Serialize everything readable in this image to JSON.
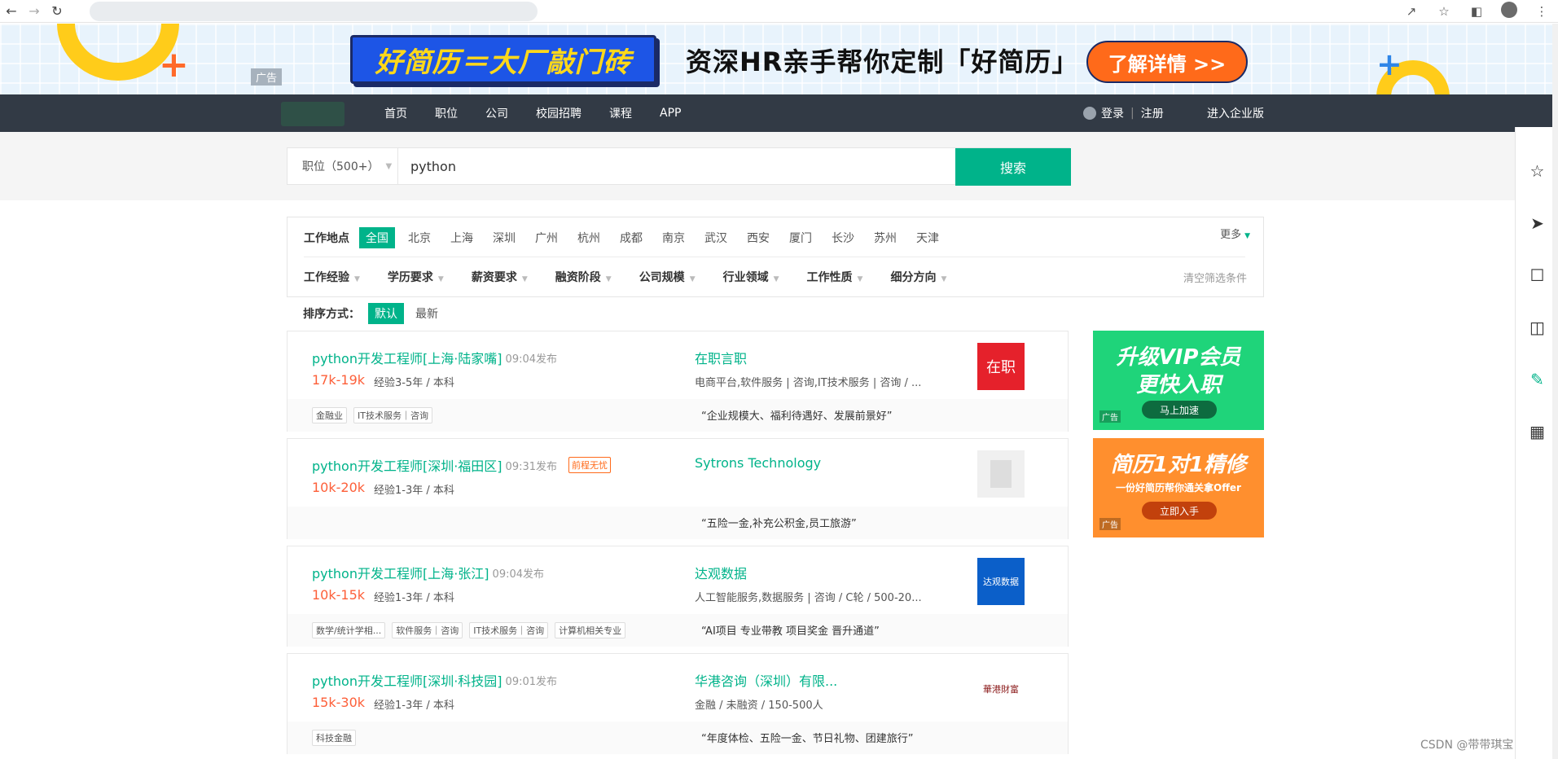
{
  "browser": {
    "icons": [
      "back-arrow-icon",
      "forward-arrow-icon",
      "reload-icon",
      "share-icon",
      "bookmark-star-icon",
      "sidebar-toggle-icon",
      "profile-icon",
      "kebab-menu-icon"
    ]
  },
  "banner": {
    "ad_label": "广告",
    "slogan_box": "好简历＝大厂敲门砖",
    "slogan_text": "资深HR亲手帮你定制「好简历」",
    "cta": "了解详情 >>"
  },
  "nav": {
    "links": [
      "首页",
      "职位",
      "公司",
      "校园招聘",
      "课程",
      "APP"
    ],
    "login": "登录",
    "register": "注册",
    "enterprise": "进入企业版"
  },
  "search": {
    "type_label": "职位（500+）",
    "query": "python",
    "button": "搜索"
  },
  "filter": {
    "location_label": "工作地点",
    "cities": [
      "全国",
      "北京",
      "上海",
      "深圳",
      "广州",
      "杭州",
      "成都",
      "南京",
      "武汉",
      "西安",
      "厦门",
      "长沙",
      "苏州",
      "天津"
    ],
    "active_city": "全国",
    "more": "更多",
    "dropdowns": [
      "工作经验",
      "学历要求",
      "薪资要求",
      "融资阶段",
      "公司规模",
      "行业领域",
      "工作性质",
      "细分方向"
    ],
    "clear": "清空筛选条件"
  },
  "sort": {
    "label": "排序方式：",
    "options": [
      "默认",
      "最新"
    ],
    "active": "默认"
  },
  "jobs": [
    {
      "position": "python开发工程师[上海·陆家嘴]",
      "time": "09:04发布",
      "badge": "",
      "salary": "17k-19k",
      "requirements": "经验3-5年 / 本科",
      "company": "在职言职",
      "industry": "电商平台,软件服务 | 咨询,IT技术服务 | 咨询 / ...",
      "logo_text": "在职",
      "logo_bg": "#e5212b",
      "logo_color": "#ffffff",
      "tags": [
        "金融业",
        "IT技术服务｜咨询"
      ],
      "benefit": "“企业规模大、福利待遇好、发展前景好”"
    },
    {
      "position": "python开发工程师[深圳·福田区]",
      "time": "09:31发布",
      "badge": "前程无忧",
      "salary": "10k-20k",
      "requirements": "经验1-3年 / 本科",
      "company": "Sytrons Technology",
      "industry": "",
      "logo_text": "",
      "logo_bg": "#f0f0f0",
      "logo_color": "#cccccc",
      "tags": [],
      "benefit": "“五险一金,补充公积金,员工旅游”"
    },
    {
      "position": "python开发工程师[上海·张江]",
      "time": "09:04发布",
      "badge": "",
      "salary": "10k-15k",
      "requirements": "经验1-3年 / 本科",
      "company": "达观数据",
      "industry": "人工智能服务,数据服务 | 咨询 / C轮 / 500-20...",
      "logo_text": "达观数据",
      "logo_bg": "#0b5fc9",
      "logo_color": "#ffffff",
      "tags": [
        "数学/统计学相...",
        "软件服务｜咨询",
        "IT技术服务｜咨询",
        "计算机相关专业"
      ],
      "benefit": "“AI项目 专业带教 项目奖金 晋升通道”"
    },
    {
      "position": "python开发工程师[深圳·科技园]",
      "time": "09:01发布",
      "badge": "",
      "salary": "15k-30k",
      "requirements": "经验1-3年 / 本科",
      "company": "华港咨询（深圳）有限...",
      "industry": "金融 / 未融资 / 150-500人",
      "logo_text": "華港財富",
      "logo_bg": "#ffffff",
      "logo_color": "#8b1a1a",
      "tags": [
        "科技金融"
      ],
      "benefit": "“年度体检、五险一金、节日礼物、团建旅行”"
    }
  ],
  "side_ads": {
    "vip": {
      "line1": "升级VIP会员",
      "line2": "更快入职",
      "cta": "马上加速",
      "ad_label": "广告"
    },
    "resume": {
      "line1": "简历1对1精修",
      "line2": "一份好简历帮你通关拿Offer",
      "cta": "立即入手",
      "ad_label": "广告"
    }
  },
  "right_sidebar": {
    "icons": [
      "star-icon",
      "paper-plane-icon",
      "resume-icon",
      "inbox-icon",
      "edit-icon",
      "qrcode-icon"
    ]
  },
  "watermark": "CSDN @带带琪宝",
  "colors": {
    "accent": "#00b38a",
    "salary": "#fd5f39",
    "nav_bg": "#323a45"
  }
}
